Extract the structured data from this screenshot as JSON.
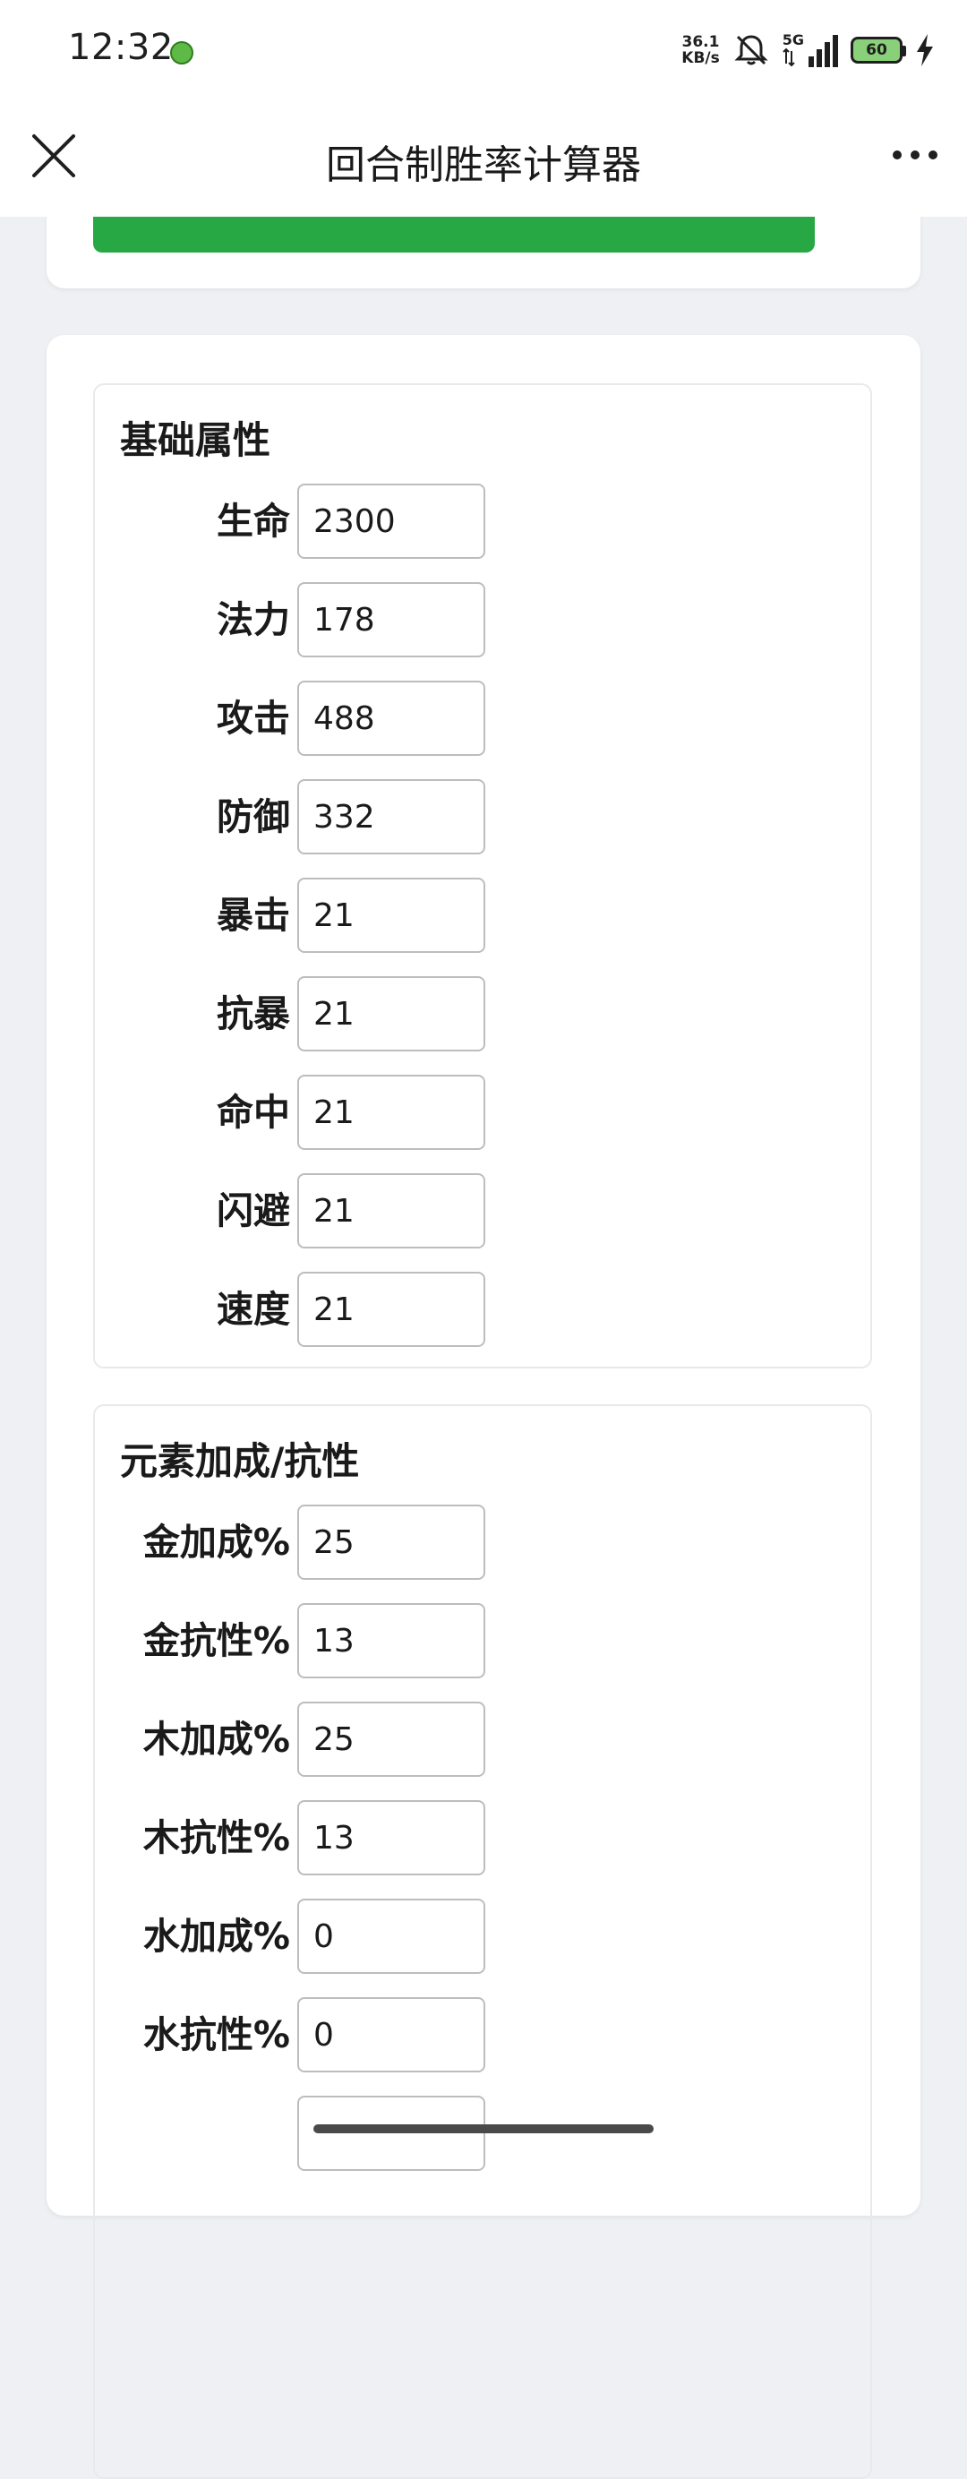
{
  "status_bar": {
    "time": "12:32",
    "net_speed_value": "36.1",
    "net_speed_unit": "KB/s",
    "network_type": "5G",
    "battery_level": "60"
  },
  "header": {
    "title": "回合制胜率计算器"
  },
  "basic_section": {
    "title": "基础属性",
    "fields": [
      {
        "label": "生命",
        "value": "2300"
      },
      {
        "label": "法力",
        "value": "178"
      },
      {
        "label": "攻击",
        "value": "488"
      },
      {
        "label": "防御",
        "value": "332"
      },
      {
        "label": "暴击",
        "value": "21"
      },
      {
        "label": "抗暴",
        "value": "21"
      },
      {
        "label": "命中",
        "value": "21"
      },
      {
        "label": "闪避",
        "value": "21"
      },
      {
        "label": "速度",
        "value": "21"
      }
    ]
  },
  "element_section": {
    "title": "元素加成/抗性",
    "fields": [
      {
        "label": "金加成%",
        "value": "25"
      },
      {
        "label": "金抗性%",
        "value": "13"
      },
      {
        "label": "木加成%",
        "value": "25"
      },
      {
        "label": "木抗性%",
        "value": "13"
      },
      {
        "label": "水加成%",
        "value": "0"
      },
      {
        "label": "水抗性%",
        "value": "0"
      }
    ]
  },
  "colors": {
    "accent_green": "#27a844",
    "background": "#eef0f4",
    "card": "#ffffff"
  }
}
